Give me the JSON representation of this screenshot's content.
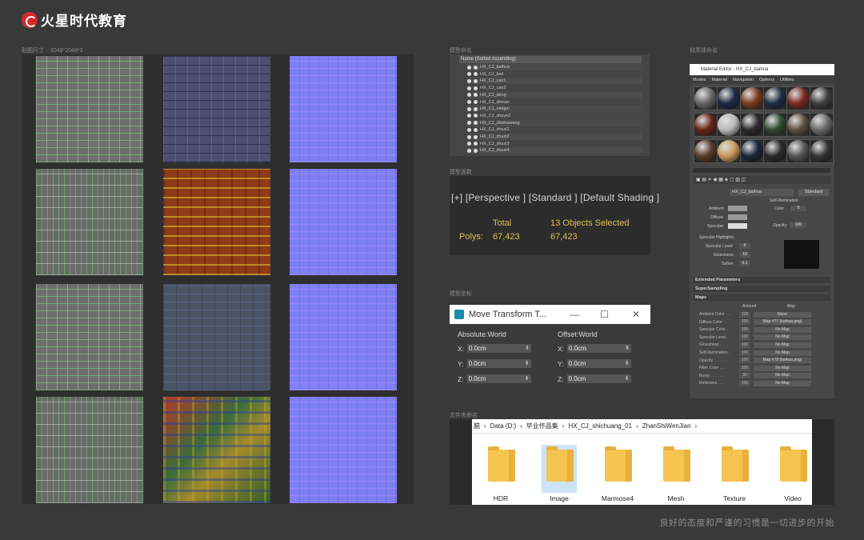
{
  "brand": {
    "name": "火星时代教育"
  },
  "sections": {
    "texture_label": "贴图尺寸",
    "texture_size": "2048*2048*3",
    "naming_label": "模型命名",
    "faces_label": "模型面数",
    "coords_label": "模型坐标",
    "material_label": "材质球命名",
    "files_label": "文件夹命名"
  },
  "object_list": {
    "header": "Name (Sorted Ascending)",
    "items": [
      "HX_CJ_baihua",
      "HX_CJ_bxd",
      "HX_CJ_cao1",
      "HX_CJ_cao2",
      "HX_CJ_deng",
      "HX_CJ_dimian",
      "HX_CJ_meigui",
      "HX_CJ_shuye2",
      "HX_CJ_zhizhuwang",
      "HX_CJ_zhuzi1",
      "HX_CJ_zhuzi2",
      "HX_CJ_zhuzi3",
      "HX_CJ_zhuzi4"
    ]
  },
  "viewport": {
    "label": "[+] [Perspective ] [Standard ] [Default Shading ]",
    "total_label": "Total",
    "selected_label": "13 Objects Selected",
    "polys_label": "Polys:",
    "polys_total": "67,423",
    "polys_selected": "67,423"
  },
  "transform": {
    "title": "Move Transform T...",
    "absolute_label": "Absolute:World",
    "offset_label": "Offset:World",
    "absolute": [
      {
        "axis": "X:",
        "value": "0.0cm"
      },
      {
        "axis": "Y:",
        "value": "0.0cm"
      },
      {
        "axis": "Z:",
        "value": "0.0cm"
      }
    ],
    "offset": [
      {
        "axis": "X:",
        "value": "0.0cm"
      },
      {
        "axis": "Y:",
        "value": "0.0cm"
      },
      {
        "axis": "Z:",
        "value": "0.0cm"
      }
    ]
  },
  "material_editor": {
    "title": "Material Editor - HX_CJ_baihua",
    "menu": [
      "Modes",
      "Material",
      "Navigation",
      "Options",
      "Utilities"
    ],
    "material_name": "HX_CJ_baihua",
    "type_button": "Standard",
    "ambient": "Ambient:",
    "diffuse": "Diffuse:",
    "specular": "Specular:",
    "self_illum": "Self-Illumination",
    "color_label": "Color",
    "color_value": "0",
    "opacity_label": "Opacity:",
    "opacity_value": "100",
    "highlights_label": "Specular Highlights",
    "spec_level_label": "Specular Level:",
    "spec_level_value": "0",
    "glossiness_label": "Glossiness:",
    "glossiness_value": "10",
    "soften_label": "Soften:",
    "soften_value": "0.1",
    "rollouts": [
      "Extended Parameters",
      "SuperSampling",
      "Maps"
    ],
    "maps_header_amount": "Amount",
    "maps_header_map": "Map",
    "maps": [
      {
        "name": "Ambient Color . . .",
        "amount": "100",
        "map": "None"
      },
      {
        "name": "Diffuse Color . . .",
        "amount": "100",
        "map": "Map #77 (baihua.png)"
      },
      {
        "name": "Specular Color . .",
        "amount": "100",
        "map": "No Map"
      },
      {
        "name": "Specular Level . .",
        "amount": "100",
        "map": "No Map"
      },
      {
        "name": "Glossiness . . . .",
        "amount": "100",
        "map": "No Map"
      },
      {
        "name": "Self-Illumination .",
        "amount": "100",
        "map": "No Map"
      },
      {
        "name": "Opacity . . . . . .",
        "amount": "100",
        "map": "Map #78 (baihua.png)"
      },
      {
        "name": "Filter Color . . .",
        "amount": "100",
        "map": "No Map"
      },
      {
        "name": "Bump . . . . . . .",
        "amount": "30",
        "map": "No Map"
      },
      {
        "name": "Reflection . . . .",
        "amount": "100",
        "map": "No Map"
      }
    ]
  },
  "explorer": {
    "path": [
      "脑",
      "Data (D:)",
      "毕业作品集",
      "HX_CJ_shichuang_01",
      "ZhanShiWenJian"
    ],
    "folders": [
      "HDR",
      "Image",
      "Marmose4",
      "Mesh",
      "Texture",
      "Video"
    ]
  },
  "tagline": "良好的态度和严谨的习惯是一切进步的开始",
  "colors": {
    "accent": "#d8262a",
    "folder": "#f5c451",
    "stat": "#e0c152"
  }
}
